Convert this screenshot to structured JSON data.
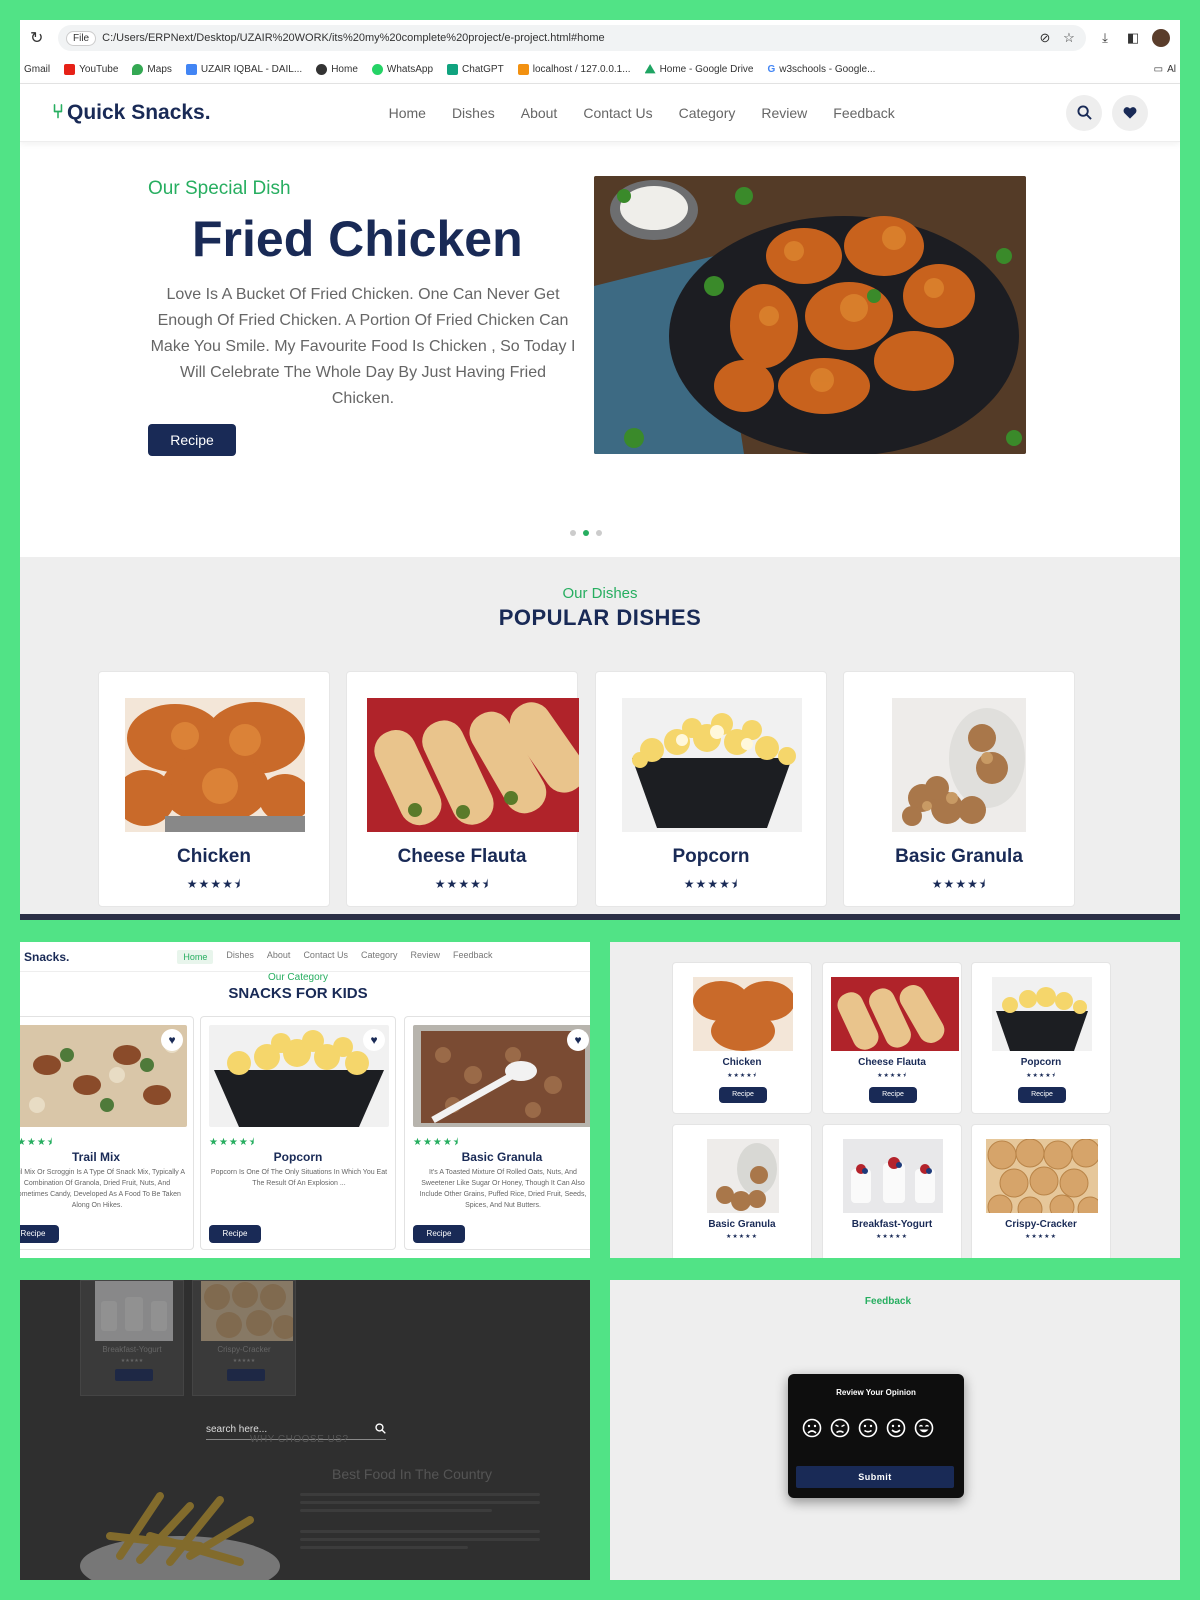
{
  "browser": {
    "file_chip": "File",
    "url": "C:/Users/ERPNext/Desktop/UZAIR%20WORK/its%20my%20complete%20project/e-project.html#home",
    "bookmarks": [
      "Gmail",
      "YouTube",
      "Maps",
      "UZAIR IQBAL - DAIL...",
      "Home",
      "WhatsApp",
      "ChatGPT",
      "localhost / 127.0.0.1...",
      "Home - Google Drive",
      "w3schools - Google..."
    ],
    "bookmark_colors": [
      "#ffffff",
      "#e62117",
      "#34a853",
      "#4285f4",
      "#333333",
      "#25d366",
      "#10a37f",
      "#f29111",
      "#1fa463",
      "#333333"
    ],
    "all_bookmarks": "Al"
  },
  "site": {
    "logo": "Quick Snacks.",
    "nav": [
      "Home",
      "Dishes",
      "About",
      "Contact Us",
      "Category",
      "Review",
      "Feedback"
    ]
  },
  "hero": {
    "subtitle": "Our Special Dish",
    "title": "Fried Chicken",
    "description": "Love Is A Bucket Of Fried Chicken. One Can Never Get Enough Of Fried Chicken. A Portion Of Fried Chicken Can Make You Smile. My Favourite Food Is Chicken , So Today I Will Celebrate The Whole Day By Just Having Fried Chicken.",
    "button": "Recipe",
    "active_slide": 2
  },
  "popular": {
    "tag": "Our Dishes",
    "title": "POPULAR DISHES",
    "items": [
      {
        "name": "Chicken",
        "stars": "★★★★⯨"
      },
      {
        "name": "Cheese Flauta",
        "stars": "★★★★⯨"
      },
      {
        "name": "Popcorn",
        "stars": "★★★★⯨"
      },
      {
        "name": "Basic Granula",
        "stars": "★★★★⯨"
      }
    ]
  },
  "kids": {
    "logo": "Snacks.",
    "nav": [
      "Home",
      "Dishes",
      "About",
      "Contact Us",
      "Category",
      "Review",
      "Feedback"
    ],
    "tag": "Our Category",
    "title": "SNACKS FOR KIDS",
    "items": [
      {
        "name": "Trail Mix",
        "stars": "★★★★⯨",
        "desc": "Trail Mix Or Scroggin Is A Type Of Snack Mix, Typically A Combination Of Granola, Dried Fruit, Nuts, And Sometimes Candy, Developed As A Food To Be Taken Along On Hikes.",
        "button": "Recipe"
      },
      {
        "name": "Popcorn",
        "stars": "★★★★⯨",
        "desc": "Popcorn Is One Of The Only Situations In Which You Eat The Result Of An Explosion ...",
        "button": "Recipe"
      },
      {
        "name": "Basic Granula",
        "stars": "★★★★⯨",
        "desc": "It's A Toasted Mixture Of Rolled Oats, Nuts, And Sweetener Like Sugar Or Honey, Though It Can Also Include Other Grains, Puffed Rice, Dried Fruit, Seeds, Spices, And Nut Butters.",
        "button": "Recipe"
      }
    ]
  },
  "grid": {
    "items": [
      {
        "name": "Chicken",
        "stars": "★★★★⯨",
        "button": "Recipe"
      },
      {
        "name": "Cheese Flauta",
        "stars": "★★★★⯨",
        "button": "Recipe"
      },
      {
        "name": "Popcorn",
        "stars": "★★★★⯨",
        "button": "Recipe"
      },
      {
        "name": "Basic Granula",
        "stars": "★★★★★"
      },
      {
        "name": "Breakfast-Yogurt",
        "stars": "★★★★★"
      },
      {
        "name": "Crispy-Cracker",
        "stars": "★★★★★"
      }
    ]
  },
  "overlay": {
    "cards": [
      {
        "name": "Breakfast-Yogurt",
        "stars": "★★★★★"
      },
      {
        "name": "Crispy-Cracker",
        "stars": "★★★★★"
      }
    ],
    "search_placeholder": "search here...",
    "why": "WHY CHOOSE US?",
    "heading": "Best Food In The Country"
  },
  "feedback": {
    "tag": "Feedback",
    "modal_title": "Review Your Opinion",
    "submit": "Submit"
  },
  "colors": {
    "navy": "#192a56",
    "green": "#27ae60",
    "frame": "#51e386"
  }
}
